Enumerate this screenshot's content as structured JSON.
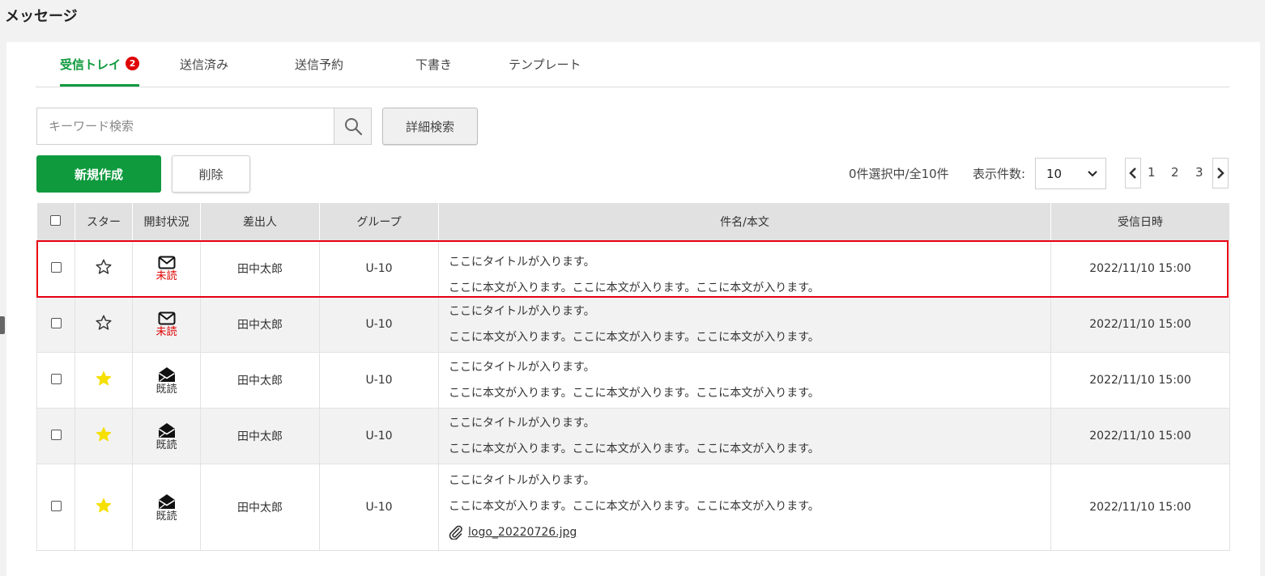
{
  "page": {
    "title": "メッセージ"
  },
  "tabs": [
    {
      "label": "受信トレイ",
      "badge": "2"
    },
    {
      "label": "送信済み"
    },
    {
      "label": "送信予約"
    },
    {
      "label": "下書き"
    },
    {
      "label": "テンプレート"
    }
  ],
  "search": {
    "placeholder": "キーワード検索",
    "advanced_label": "詳細検索"
  },
  "actions": {
    "new_label": "新規作成",
    "delete_label": "削除"
  },
  "list_info": {
    "selection_text": "0件選択中/全10件",
    "per_page_label": "表示件数:",
    "per_page_value": "10",
    "pages": [
      "1",
      "2",
      "3"
    ]
  },
  "table": {
    "headers": [
      "スター",
      "開封状況",
      "差出人",
      "グループ",
      "件名/本文",
      "受信日時"
    ],
    "rows": [
      {
        "starred": false,
        "status": "未読",
        "sender": "田中太郎",
        "group": "U-10",
        "title": "ここにタイトルが入ります。",
        "body": "ここに本文が入ります。ここに本文が入ります。ここに本文が入ります。",
        "date": "2022/11/10 15:00"
      },
      {
        "starred": false,
        "status": "未読",
        "sender": "田中太郎",
        "group": "U-10",
        "title": "ここにタイトルが入ります。",
        "body": "ここに本文が入ります。ここに本文が入ります。ここに本文が入ります。",
        "date": "2022/11/10 15:00"
      },
      {
        "starred": true,
        "status": "既読",
        "sender": "田中太郎",
        "group": "U-10",
        "title": "ここにタイトルが入ります。",
        "body": "ここに本文が入ります。ここに本文が入ります。ここに本文が入ります。",
        "date": "2022/11/10 15:00"
      },
      {
        "starred": true,
        "status": "既読",
        "sender": "田中太郎",
        "group": "U-10",
        "title": "ここにタイトルが入ります。",
        "body": "ここに本文が入ります。ここに本文が入ります。ここに本文が入ります。",
        "date": "2022/11/10 15:00"
      },
      {
        "starred": true,
        "status": "既読",
        "sender": "田中太郎",
        "group": "U-10",
        "title": "ここにタイトルが入ります。",
        "body": "ここに本文が入ります。ここに本文が入ります。ここに本文が入ります。",
        "date": "2022/11/10 15:00",
        "attachment": "logo_20220726.jpg"
      }
    ]
  },
  "colors": {
    "accent": "#0f9a3e",
    "unread": "#e00000",
    "badge": "#e00000",
    "star_filled": "#f5e000",
    "highlight": "#e60012"
  }
}
